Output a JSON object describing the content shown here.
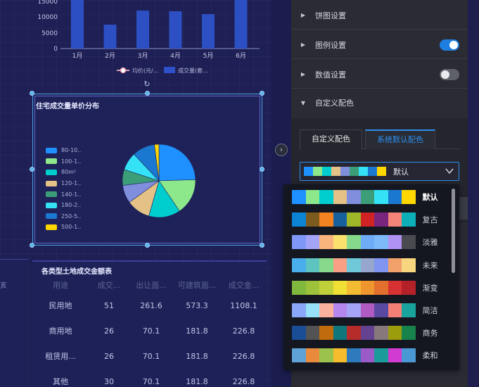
{
  "bar_chart": {
    "y_ticks": [
      "15000",
      "10000",
      "5000",
      "0"
    ],
    "months": [
      "1月",
      "2月",
      "3月",
      "4月",
      "5月",
      "6月"
    ],
    "legend": [
      {
        "label": "均价(元/...",
        "color": "#e8a0b4"
      },
      {
        "label": "成交量(套...",
        "color": "#2e50c8"
      }
    ]
  },
  "chart_data": {
    "type": "pie",
    "title": "住宅成交量单价分布",
    "legend": [
      "80-10..",
      "100-1..",
      "80m²",
      "120-1..",
      "140-1..",
      "180-2..",
      "250-5..",
      "500-1.."
    ],
    "colors": [
      "#1e90ff",
      "#8de88b",
      "#00cdcd",
      "#e3c187",
      "#3c9e78",
      "#34e1f5",
      "#1b78d0",
      "#ffd700"
    ],
    "values": [
      24.5,
      16,
      14,
      10.5,
      7,
      8,
      10,
      2
    ],
    "extra_slices": [
      {
        "color": "#7f8fde",
        "value": 8
      }
    ]
  },
  "table": {
    "title": "各类型土地成交金额表",
    "headers": [
      "用途",
      "成交...",
      "出让面...",
      "可建筑面...",
      "成交金..."
    ],
    "rows": [
      [
        "民用地",
        "51",
        "261.6",
        "573.3",
        "1108.1"
      ],
      [
        "商用地",
        "26",
        "70.1",
        "181.8",
        "226.8"
      ],
      [
        "租赁用...",
        "26",
        "70.1",
        "181.8",
        "226.8"
      ],
      [
        "其他",
        "30",
        "70.1",
        "181.8",
        "226.8"
      ]
    ]
  },
  "left_rail_text": "亥",
  "panel": {
    "sections": [
      {
        "label": "饼图设置",
        "expanded": false,
        "toggle": null
      },
      {
        "label": "图例设置",
        "expanded": false,
        "toggle": true
      },
      {
        "label": "数值设置",
        "expanded": false,
        "toggle": false
      },
      {
        "label": "自定义配色",
        "expanded": true,
        "toggle": null
      }
    ],
    "tabs": [
      "自定义配色",
      "系统默认配色"
    ],
    "selected_scheme": "默认"
  },
  "color_schemes": [
    {
      "name": "默认",
      "colors": [
        "#1e90ff",
        "#8de88b",
        "#00cdcd",
        "#e3c187",
        "#7f8fde",
        "#3c9e78",
        "#34e1f5",
        "#1b78d0",
        "#ffd700"
      ]
    },
    {
      "name": "复古",
      "colors": [
        "#0c84d4",
        "#7b5c1e",
        "#f58220",
        "#16609e",
        "#9fb629",
        "#d22324",
        "#79257d",
        "#f4837a",
        "#0db0b7"
      ]
    },
    {
      "name": "淡雅",
      "colors": [
        "#7f97f7",
        "#a4a4f7",
        "#f9b47e",
        "#fae16e",
        "#86d98a",
        "#6eacf7",
        "#7ebaf9",
        "#b091f4",
        "#494a50"
      ]
    },
    {
      "name": "未来",
      "colors": [
        "#4aaeec",
        "#5ec4c0",
        "#88d98b",
        "#f89f85",
        "#70c9d8",
        "#97a6cd",
        "#7f95f0",
        "#f3a16a",
        "#f8d57f"
      ]
    },
    {
      "name": "渐变",
      "colors": [
        "#80b83e",
        "#9dc13a",
        "#c0d03a",
        "#f0df34",
        "#f2bb31",
        "#f0962f",
        "#e36f2e",
        "#d83131",
        "#b52129"
      ]
    },
    {
      "name": "简洁",
      "colors": [
        "#8aa6f9",
        "#96e1f7",
        "#fab29e",
        "#b587ee",
        "#a5a3f5",
        "#af5bc2",
        "#5a49a2",
        "#f57e75",
        "#18a39d"
      ]
    },
    {
      "name": "商务",
      "colors": [
        "#194e97",
        "#545353",
        "#c06b0e",
        "#11767c",
        "#b52c2b",
        "#644291",
        "#86787b",
        "#9b9d0d",
        "#18824c"
      ]
    },
    {
      "name": "柔和",
      "colors": [
        "#5ea2d7",
        "#e98a3d",
        "#9ac24c",
        "#f6bc2e",
        "#2f79bd",
        "#9a5bc6",
        "#1c9b9b",
        "#d13bd0",
        "#4a98d4"
      ]
    }
  ]
}
